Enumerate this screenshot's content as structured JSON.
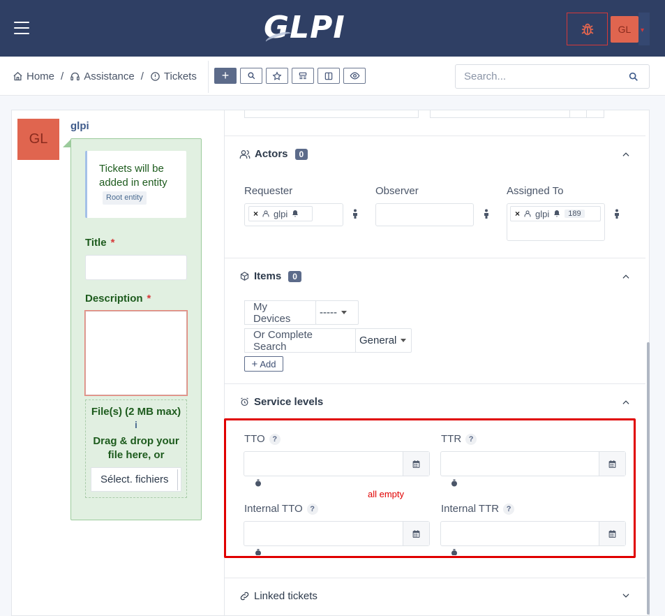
{
  "app": {
    "logo_text": "GLPI"
  },
  "header": {
    "user_initials": "GL"
  },
  "breadcrumb": {
    "home": "Home",
    "assistance": "Assistance",
    "tickets": "Tickets"
  },
  "search": {
    "placeholder": "Search..."
  },
  "timeline": {
    "user_initials": "GL",
    "user_name": "glpi",
    "entity_notice": "Tickets will be added in entity",
    "entity_badge": "Root entity",
    "title_label": "Title",
    "description_label": "Description",
    "required_mark": "*",
    "file_title": "File(s) (2 MB max)",
    "file_info": "i",
    "file_drop": "Drag & drop your file here, or",
    "file_button": "Sélect. fichiers"
  },
  "actors": {
    "title": "Actors",
    "count": "0",
    "requester_label": "Requester",
    "observer_label": "Observer",
    "assigned_label": "Assigned To",
    "requester_user": "glpi",
    "assigned_user": "glpi",
    "assigned_count": "189",
    "remove_glyph": "×"
  },
  "items": {
    "title": "Items",
    "count": "0",
    "my_devices_label": "My Devices",
    "my_devices_value": "-----",
    "complete_search_label": "Or Complete Search",
    "complete_search_value": "General",
    "add_label": "Add",
    "add_glyph": "+"
  },
  "service_levels": {
    "title": "Service levels",
    "tto_label": "TTO",
    "ttr_label": "TTR",
    "internal_tto_label": "Internal TTO",
    "internal_ttr_label": "Internal TTR",
    "help_glyph": "?",
    "tto_value": "",
    "ttr_value": "",
    "internal_tto_value": "",
    "internal_ttr_value": "",
    "annotation": "all empty"
  },
  "linked": {
    "title": "Linked tickets"
  },
  "colors": {
    "navbar": "#2f3f64",
    "accent": "#5c6b8a",
    "annotation_red": "#e00000",
    "timeline_green": "#e1f0e1",
    "avatar": "#e0654f"
  }
}
